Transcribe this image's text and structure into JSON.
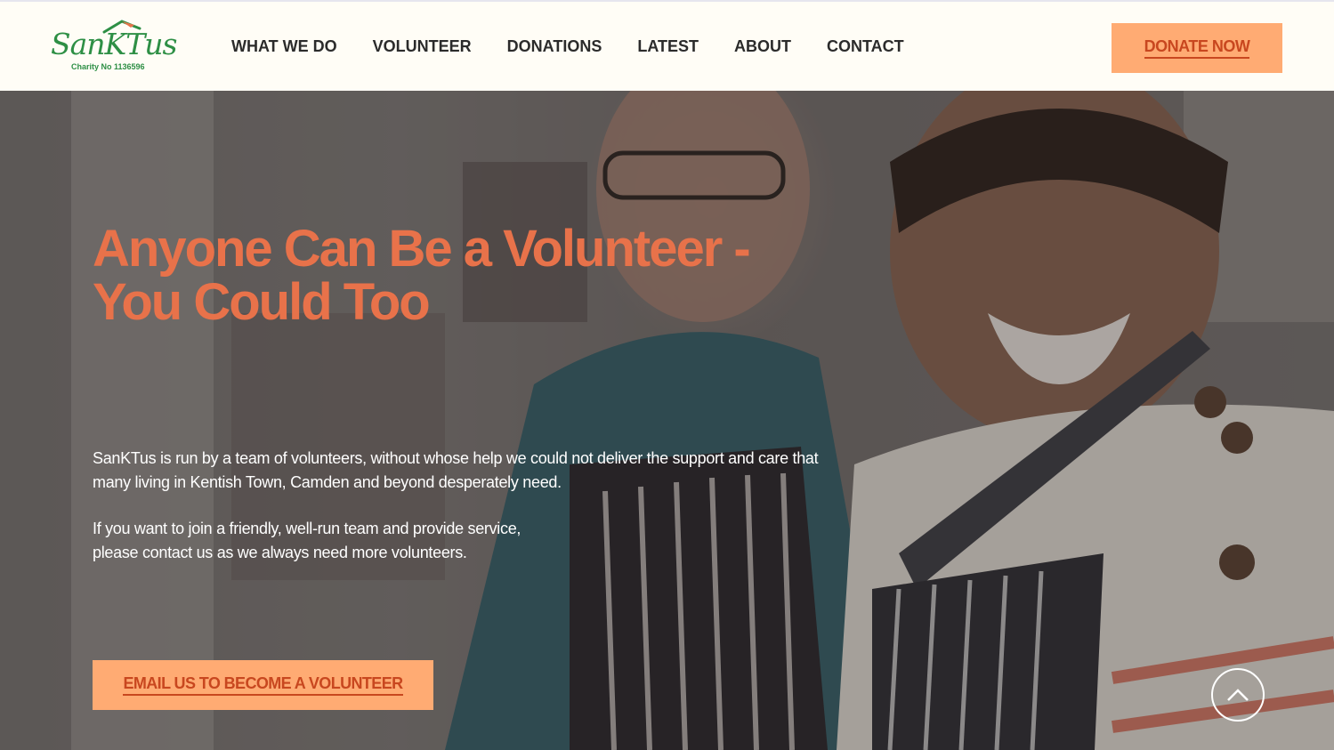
{
  "logo": {
    "name": "SanKTus",
    "charity_no": "Charity No 1136596"
  },
  "nav": {
    "items": [
      "WHAT WE DO",
      "VOLUNTEER",
      "DONATIONS",
      "LATEST",
      "ABOUT",
      "CONTACT"
    ]
  },
  "header": {
    "donate_label": "DONATE NOW"
  },
  "hero": {
    "title": "Anyone Can Be a Volunteer - You Could Too",
    "paragraph1": "SanKTus is run by a team of volunteers, without whose help we could not deliver the support and care that many living in Kentish Town, Camden and beyond desperately need.",
    "paragraph2_line1": "If you want to join a friendly, well-run team and provide service,",
    "paragraph2_line2": "please contact us as we always need more volunteers.",
    "cta_label": "EMAIL US TO BECOME A VOLUNTEER"
  },
  "colors": {
    "accent": "#e8724a",
    "button_bg": "#ffab73",
    "button_text": "#c8471f",
    "brand_green": "#2e8f45",
    "header_bg": "#fffdf6"
  },
  "icons": {
    "scroll_top": "chevron-up-icon"
  }
}
